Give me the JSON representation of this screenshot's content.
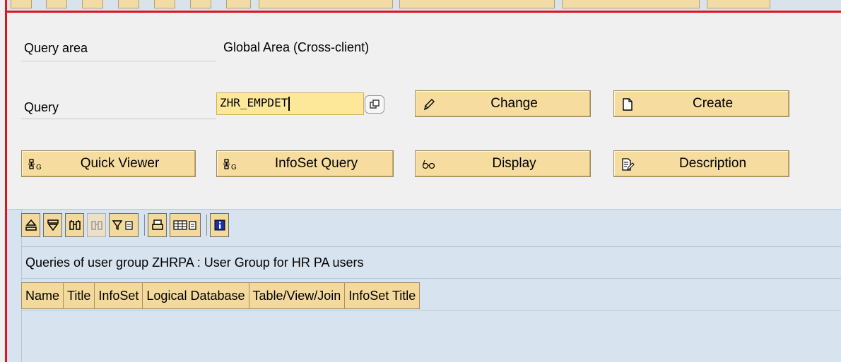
{
  "query_area": {
    "label": "Query area",
    "value": "Global Area (Cross-client)"
  },
  "query": {
    "label": "Query",
    "input_value": "ZHR_EMPDET"
  },
  "buttons": {
    "change": "Change",
    "create": "Create",
    "quick_viewer": "Quick Viewer",
    "infoset_query": "InfoSet Query",
    "display": "Display",
    "description": "Description"
  },
  "alv": {
    "title": "Queries of user group ZHRPA : User Group for HR PA users",
    "columns": [
      "Name",
      "Title",
      "InfoSet",
      "Logical Database",
      "Table/View/Join",
      "InfoSet Title"
    ],
    "toolbar_icons": [
      "sort-ascending-icon",
      "filter-icon",
      "find-icon",
      "find-next-icon",
      "set-filter-icon",
      "print-icon",
      "layout-icon",
      "information-icon"
    ]
  },
  "colors": {
    "button_fill": "#f6dc9f",
    "input_fill": "#fde89a",
    "panel_blue": "#d7e3ef",
    "frame_red": "#e8101b"
  }
}
